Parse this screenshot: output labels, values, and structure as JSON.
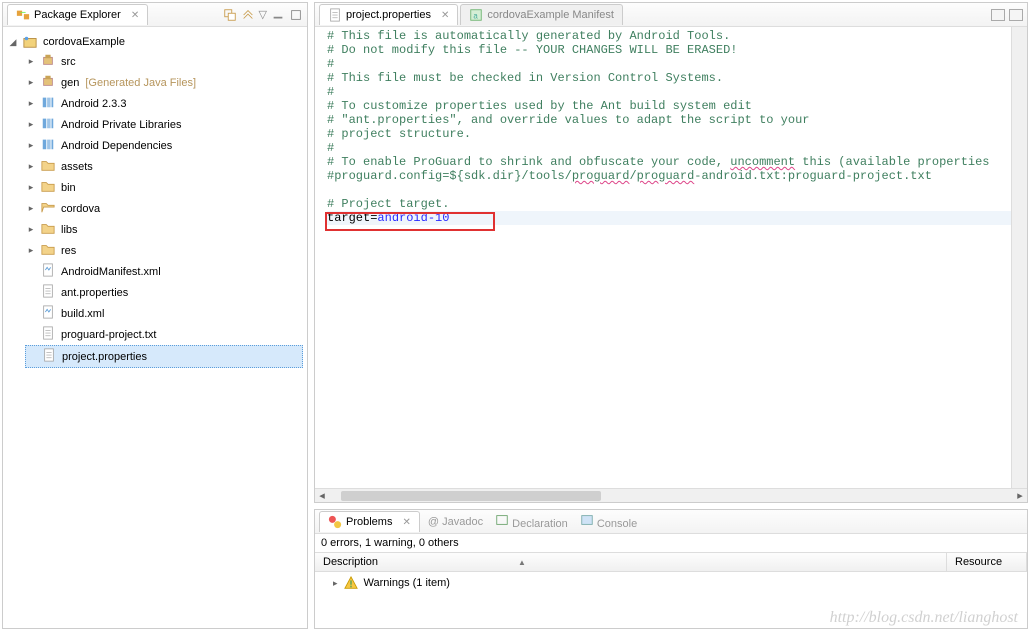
{
  "explorer": {
    "title": "Package Explorer",
    "project": "cordovaExample",
    "items": [
      {
        "label": "src",
        "icon": "pkg"
      },
      {
        "label": "gen",
        "hint": "[Generated Java Files]",
        "icon": "pkg"
      },
      {
        "label": "Android 2.3.3",
        "icon": "lib"
      },
      {
        "label": "Android Private Libraries",
        "icon": "lib"
      },
      {
        "label": "Android Dependencies",
        "icon": "lib"
      },
      {
        "label": "assets",
        "icon": "folder"
      },
      {
        "label": "bin",
        "icon": "folder"
      },
      {
        "label": "cordova",
        "icon": "folder-open"
      },
      {
        "label": "libs",
        "icon": "folder"
      },
      {
        "label": "res",
        "icon": "folder"
      }
    ],
    "files": [
      {
        "label": "AndroidManifest.xml",
        "icon": "xml"
      },
      {
        "label": "ant.properties",
        "icon": "file"
      },
      {
        "label": "build.xml",
        "icon": "xml"
      },
      {
        "label": "proguard-project.txt",
        "icon": "file"
      },
      {
        "label": "project.properties",
        "icon": "file",
        "selected": true
      }
    ]
  },
  "editor": {
    "tabs": [
      {
        "label": "project.properties",
        "active": true,
        "icon": "file"
      },
      {
        "label": "cordovaExample Manifest",
        "active": false,
        "icon": "manifest"
      }
    ],
    "comments": [
      "# This file is automatically generated by Android Tools.",
      "# Do not modify this file -- YOUR CHANGES WILL BE ERASED!",
      "#",
      "# This file must be checked in Version Control Systems.",
      "#",
      "# To customize properties used by the Ant build system edit",
      "# \"ant.properties\", and override values to adapt the script to your",
      "# project structure.",
      "#",
      "# To enable ProGuard to shrink and obfuscate your code, uncomment this (available properties",
      "#proguard.config=${sdk.dir}/tools/proguard/proguard-android.txt:proguard-project.txt",
      "",
      "# Project target."
    ],
    "target_key": "target",
    "target_val": "android-10"
  },
  "problems": {
    "tabs": [
      "Problems",
      "Javadoc",
      "Declaration",
      "Console"
    ],
    "status": "0 errors, 1 warning, 0 others",
    "columns": [
      "Description",
      "Resource"
    ],
    "rows": [
      {
        "label": "Warnings (1 item)",
        "icon": "warn"
      }
    ]
  },
  "watermark": "http://blog.csdn.net/lianghost"
}
